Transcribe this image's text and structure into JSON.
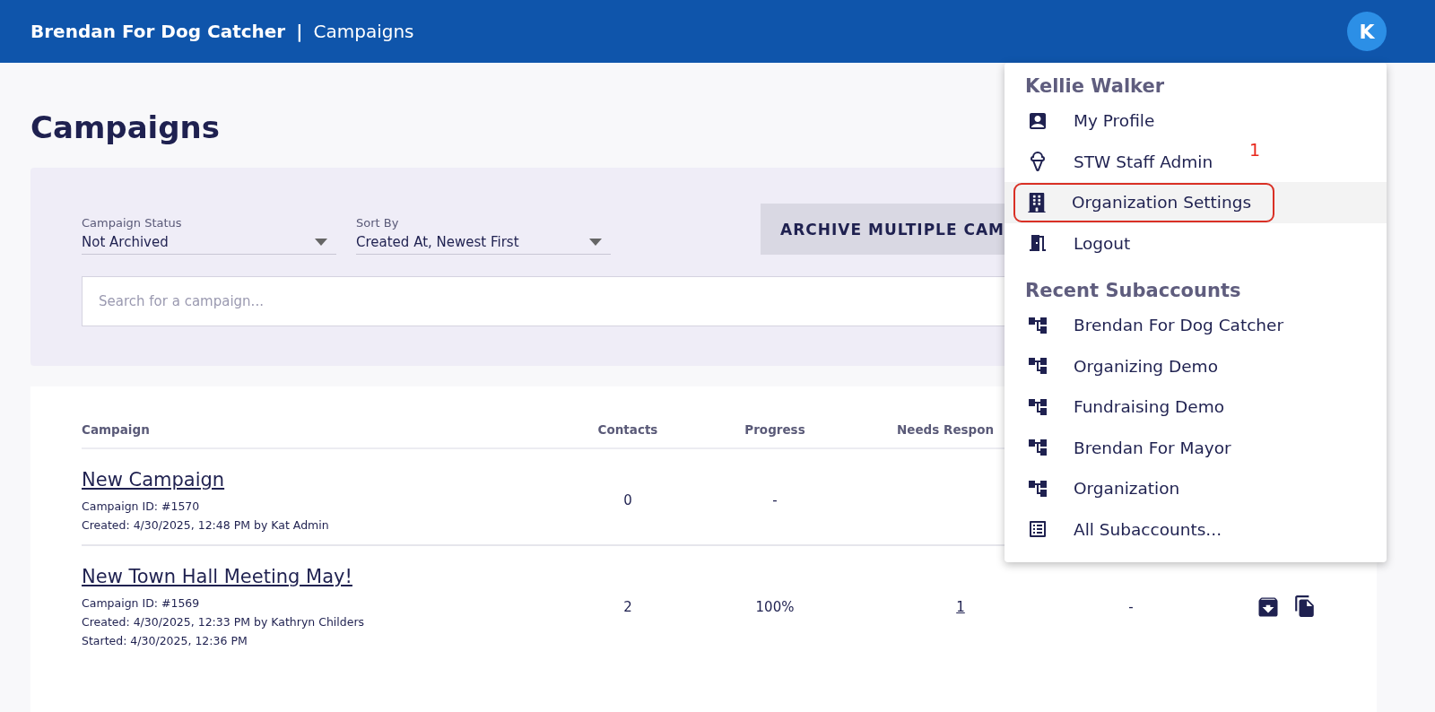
{
  "header": {
    "brand": "Brendan For Dog Catcher",
    "separator": "|",
    "page": "Campaigns",
    "avatar": "K"
  },
  "title": "Campaigns",
  "filters": {
    "status": {
      "label": "Campaign Status",
      "value": "Not Archived"
    },
    "sort": {
      "label": "Sort By",
      "value": "Created At, Newest First"
    },
    "archive_button": "ARCHIVE MULTIPLE CAM",
    "search": {
      "placeholder": "Search for a campaign..."
    }
  },
  "table": {
    "columns": [
      "Campaign",
      "Contacts",
      "Progress",
      "Needs Respon"
    ],
    "rows": [
      {
        "name": "New Campaign",
        "details": [
          "Campaign ID: #1570",
          "Created: 4/30/2025, 12:48 PM by Kat Admin"
        ],
        "contacts": "0",
        "progress": "-"
      },
      {
        "name": "New Town Hall Meeting May!",
        "details": [
          "Campaign ID: #1569",
          "Created: 4/30/2025, 12:33 PM by Kathryn Childers",
          "Started: 4/30/2025, 12:36 PM"
        ],
        "contacts": "2",
        "progress": "100%",
        "needs_response": "1",
        "column_5": "-"
      }
    ]
  },
  "menu": {
    "user": "Kellie Walker",
    "items": [
      {
        "label": "My Profile",
        "highlighted": false
      },
      {
        "label": "STW Staff Admin",
        "highlighted": false,
        "annotation": "1"
      },
      {
        "label": "Organization Settings",
        "highlighted": true
      },
      {
        "label": "Logout",
        "highlighted": false
      }
    ],
    "section": "Recent Subaccounts",
    "subaccounts": [
      {
        "label": "Brendan For Dog Catcher",
        "kind": "subaccount"
      },
      {
        "label": "Organizing Demo",
        "kind": "subaccount"
      },
      {
        "label": "Fundraising Demo",
        "kind": "subaccount"
      },
      {
        "label": "Brendan For Mayor",
        "kind": "subaccount"
      },
      {
        "label": "Organization",
        "kind": "subaccount"
      },
      {
        "label": "All Subaccounts...",
        "kind": "all"
      }
    ]
  }
}
